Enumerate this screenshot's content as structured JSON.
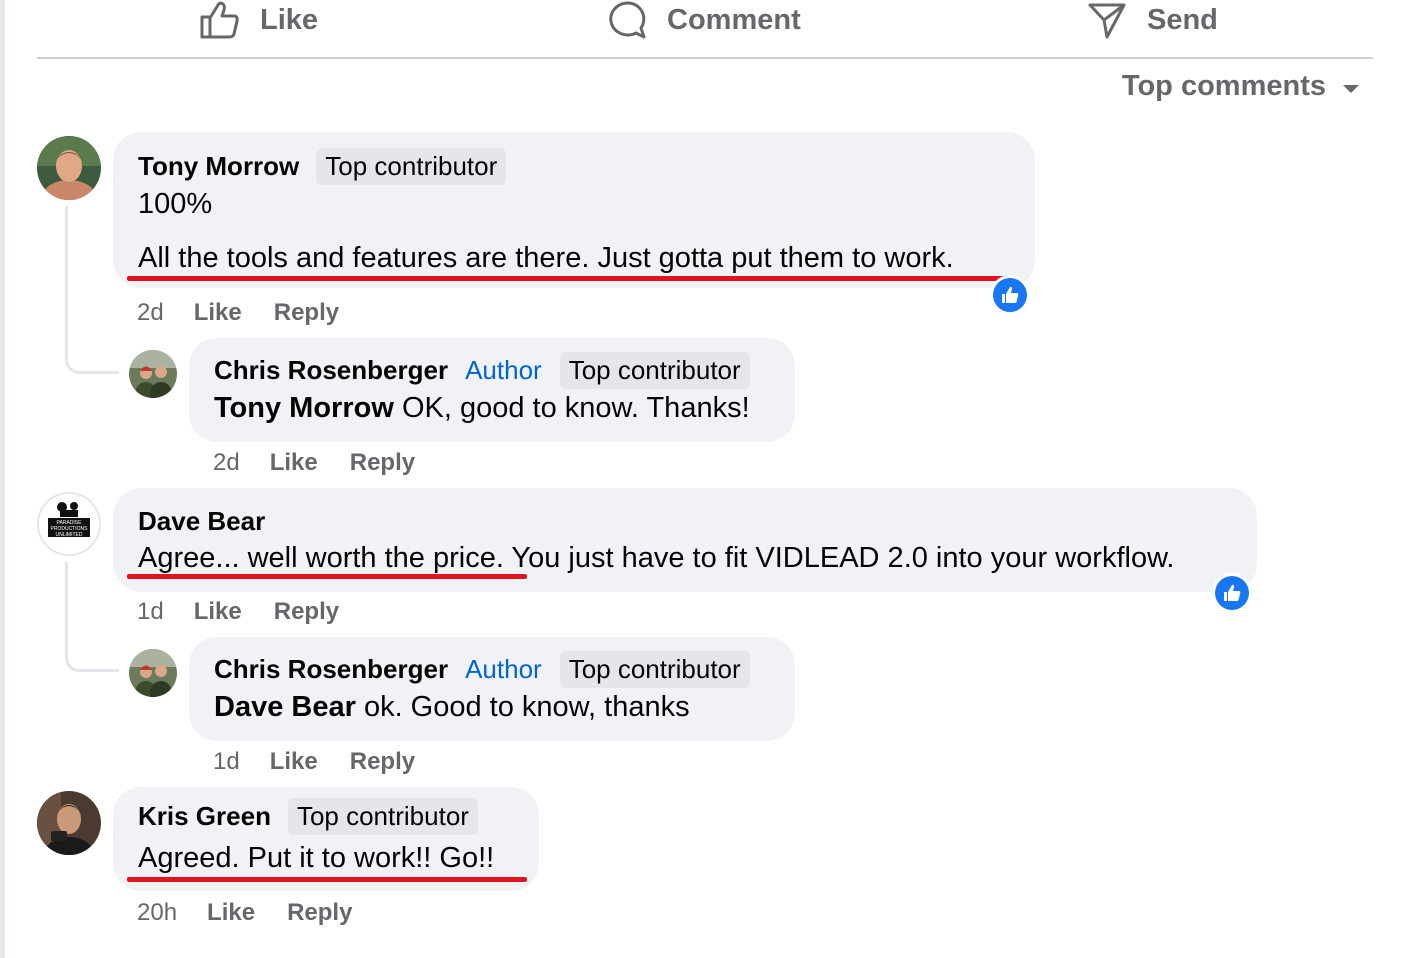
{
  "actions": {
    "like": "Like",
    "comment": "Comment",
    "send": "Send"
  },
  "sort_label": "Top comments",
  "comments": [
    {
      "name": "Tony Morrow",
      "badge": "Top contributor",
      "line1": "100%",
      "line2": "All the tools and features are there. Just gotta put them to work.",
      "time": "2d",
      "like": "Like",
      "reply": "Reply"
    },
    {
      "name": "Chris Rosenberger",
      "author_badge": "Author",
      "badge": "Top contributor",
      "mention": "Tony Morrow",
      "text": "OK, good to know. Thanks!",
      "time": "2d",
      "like": "Like",
      "reply": "Reply"
    },
    {
      "name": "Dave Bear",
      "text_a": "Agree... well worth the price.",
      "text_b": " You just have to fit VIDLEAD 2.0 into your workflow.",
      "time": "1d",
      "like": "Like",
      "reply": "Reply",
      "avatar_text": "PARADISE PRODUCTIONS UNLIMITED"
    },
    {
      "name": "Chris Rosenberger",
      "author_badge": "Author",
      "badge": "Top contributor",
      "mention": "Dave Bear",
      "text": "ok. Good to know, thanks",
      "time": "1d",
      "like": "Like",
      "reply": "Reply"
    },
    {
      "name": "Kris Green",
      "badge": "Top contributor",
      "text": "Agreed. Put it to work!! Go!!",
      "time": "20h",
      "like": "Like",
      "reply": "Reply"
    }
  ],
  "colors": {
    "bubble": "#f0f2f5",
    "badge": "#e4e6eb",
    "author": "#0064d1",
    "meta": "#65676b",
    "like_blue": "#1877f2",
    "underline": "#e0141e"
  },
  "icons": [
    "thumbs-up-icon",
    "comment-icon",
    "send-icon",
    "caret-down-icon",
    "like-reaction-icon"
  ]
}
